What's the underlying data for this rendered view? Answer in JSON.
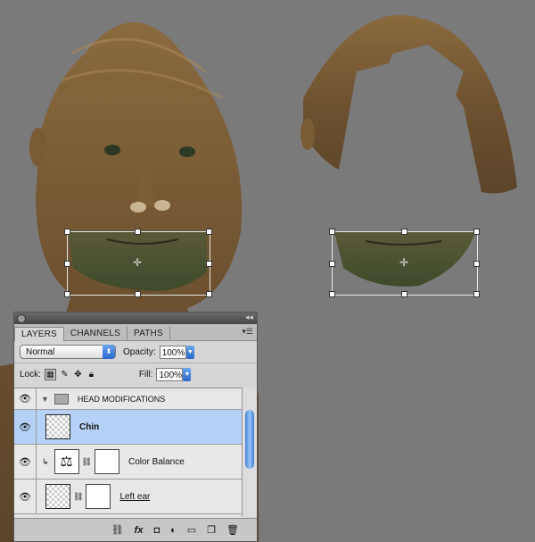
{
  "panel": {
    "tabs": [
      "LAYERS",
      "CHANNELS",
      "PATHS"
    ],
    "blend_mode": "Normal",
    "opacity_label": "Opacity:",
    "opacity_value": "100%",
    "lock_label": "Lock:",
    "fill_label": "Fill:",
    "fill_value": "100%",
    "layers": [
      {
        "name": "HEAD MODIFICATIONS",
        "type": "group"
      },
      {
        "name": "Chin",
        "type": "layer",
        "selected": true
      },
      {
        "name": "Color Balance",
        "type": "adjustment"
      },
      {
        "name": "Left ear",
        "type": "layer"
      }
    ],
    "footer_icons": [
      "link-icon",
      "fx-icon",
      "mask-icon",
      "adjustment-icon",
      "folder-icon",
      "new-layer-icon",
      "trash-icon"
    ]
  },
  "colors": {
    "canvas_bg": "#7a7a7a",
    "selection": "#b5d1f7"
  }
}
